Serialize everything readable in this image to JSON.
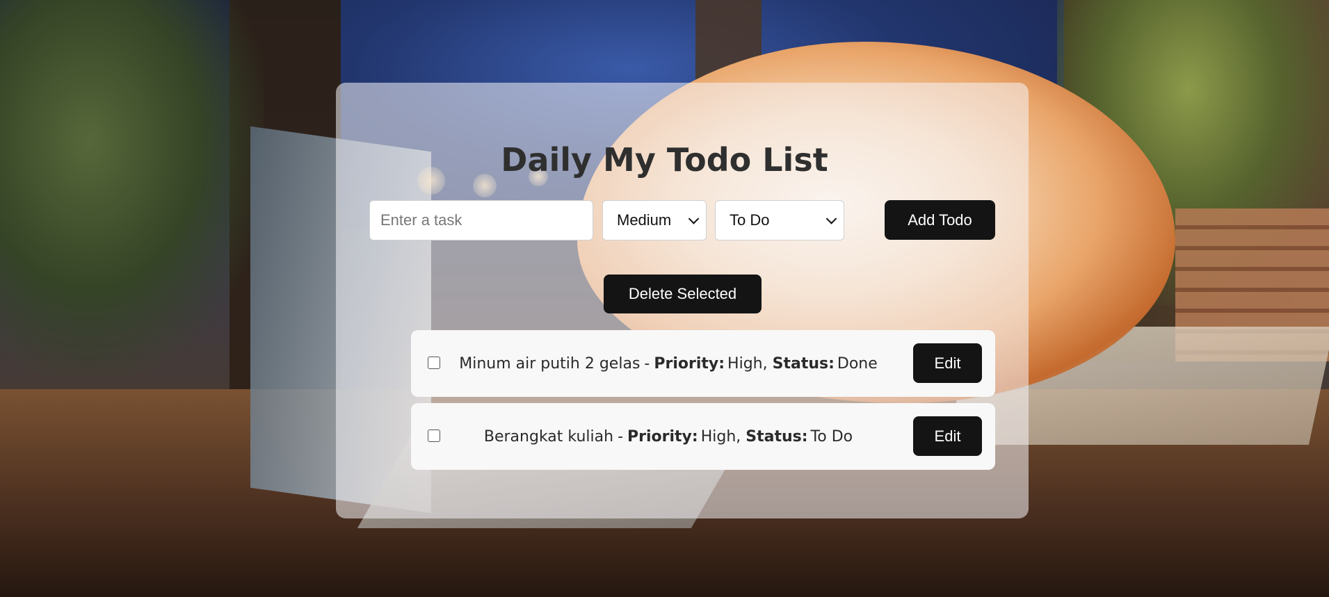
{
  "app": {
    "title": "Daily My Todo List"
  },
  "form": {
    "task_placeholder": "Enter a task",
    "task_value": "",
    "priority_selected": "Medium",
    "status_selected": "To Do",
    "add_label": "Add Todo"
  },
  "actions": {
    "delete_selected_label": "Delete Selected"
  },
  "todos": [
    {
      "task": "Minum air putih 2 gelas",
      "separator": "-",
      "priority_label": "Priority:",
      "priority": "High,",
      "status_label": "Status:",
      "status": "Done",
      "checked": false,
      "edit_label": "Edit"
    },
    {
      "task": "Berangkat kuliah",
      "separator": "-",
      "priority_label": "Priority:",
      "priority": "High,",
      "status_label": "Status:",
      "status": "To Do",
      "checked": false,
      "edit_label": "Edit"
    }
  ],
  "colors": {
    "button_bg": "#141414",
    "button_text": "#ffffff",
    "card_bg": "rgba(245,244,248,0.55)",
    "item_bg": "#f8f8f8",
    "title_text": "#2f2f2f"
  }
}
